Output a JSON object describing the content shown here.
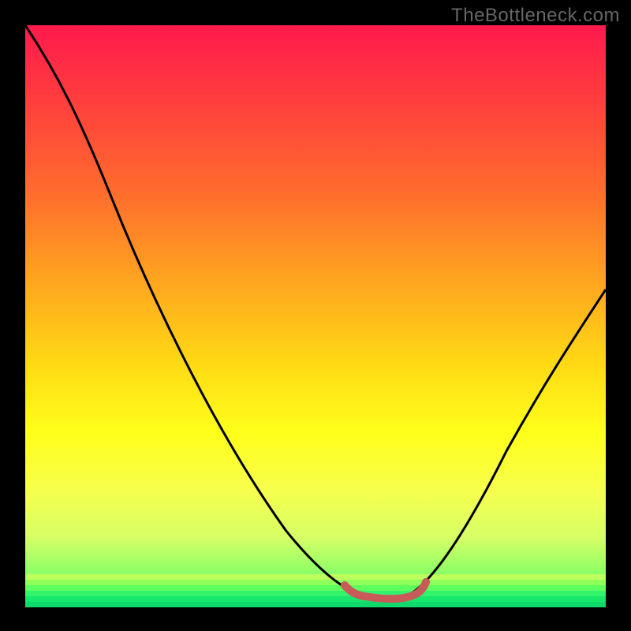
{
  "watermark": "TheBottleneck.com",
  "chart_data": {
    "type": "line",
    "title": "",
    "xlabel": "",
    "ylabel": "",
    "xlim": [
      0,
      100
    ],
    "ylim": [
      0,
      100
    ],
    "grid": false,
    "legend": false,
    "background_gradient": [
      "#ff1a4d",
      "#ffa51f",
      "#ffff1a",
      "#33ff66"
    ],
    "series": [
      {
        "name": "left-branch",
        "color": "#000000",
        "x": [
          0,
          10,
          20,
          30,
          40,
          50,
          55,
          58
        ],
        "y": [
          100,
          84,
          66,
          48,
          30,
          10,
          3,
          1
        ]
      },
      {
        "name": "trough",
        "color": "#c85a5a",
        "x": [
          55,
          58,
          62,
          66,
          68
        ],
        "y": [
          3,
          1,
          1,
          1,
          3
        ]
      },
      {
        "name": "right-branch",
        "color": "#000000",
        "x": [
          66,
          70,
          80,
          90,
          100
        ],
        "y": [
          1,
          6,
          22,
          38,
          55
        ]
      }
    ],
    "notes": "V-shaped bottleneck curve over vertical rainbow gradient. No axis ticks or labels visible; values estimated from pixel positions on a 0–100 normalized grid."
  }
}
